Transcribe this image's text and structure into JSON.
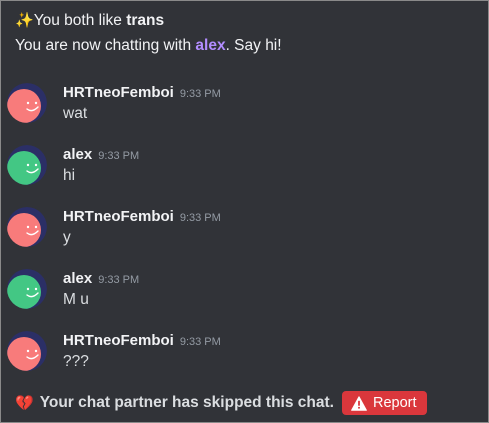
{
  "header": {
    "sparkle_icon": "✨",
    "like_prefix": "You both like ",
    "shared_interest": "trans",
    "chatting_prefix": "You are now chatting with ",
    "partner_name": "alex",
    "chatting_suffix": ". Say hi!"
  },
  "messages": [
    {
      "author": "HRTneoFemboi",
      "time": "9:33 PM",
      "text": "wat",
      "avatar_icon": "smiley-avatar-icon",
      "avatar_color": "#f87b7b"
    },
    {
      "author": "alex",
      "time": "9:33 PM",
      "text": "hi",
      "avatar_icon": "smiley-avatar-icon",
      "avatar_color": "#43c784"
    },
    {
      "author": "HRTneoFemboi",
      "time": "9:33 PM",
      "text": "y",
      "avatar_icon": "smiley-avatar-icon",
      "avatar_color": "#f87b7b"
    },
    {
      "author": "alex",
      "time": "9:33 PM",
      "text": "M u",
      "avatar_icon": "smiley-avatar-icon",
      "avatar_color": "#43c784"
    },
    {
      "author": "HRTneoFemboi",
      "time": "9:33 PM",
      "text": "???",
      "avatar_icon": "smiley-avatar-icon",
      "avatar_color": "#f87b7b"
    }
  ],
  "footer": {
    "broken_heart_icon": "💔",
    "skip_text": "Your chat partner has skipped this chat.",
    "report_label": "Report",
    "report_icon": "warning-icon",
    "report_color": "#da373c"
  },
  "colors": {
    "background": "#313338",
    "partner_name": "#b28dff",
    "timestamp": "#949ba4"
  }
}
